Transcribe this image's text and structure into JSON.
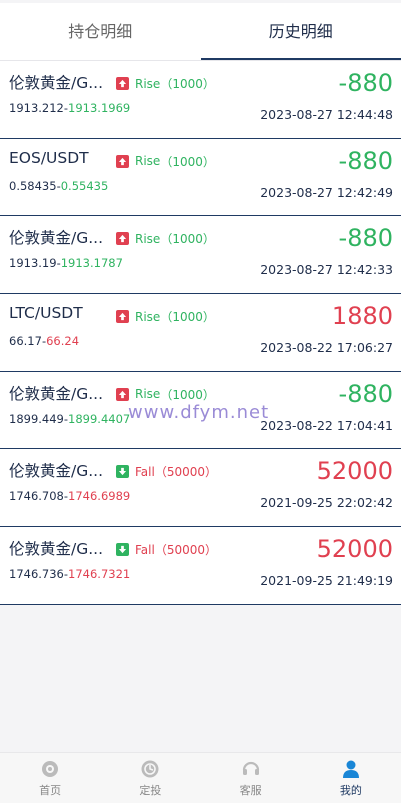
{
  "tabs": [
    {
      "label": "持仓明细",
      "active": false
    },
    {
      "label": "历史明细",
      "active": true
    }
  ],
  "records": [
    {
      "name": "伦敦黄金/G...",
      "direction": "Rise",
      "qty": "（1000）",
      "open": "1913.212",
      "close": "1913.1969",
      "close_color": "green",
      "amount": "-880",
      "amount_color": "green",
      "time": "2023-08-27 12:44:48"
    },
    {
      "name": "EOS/USDT",
      "direction": "Rise",
      "qty": "（1000）",
      "open": "0.58435",
      "close": "0.55435",
      "close_color": "green",
      "amount": "-880",
      "amount_color": "green",
      "time": "2023-08-27 12:42:49"
    },
    {
      "name": "伦敦黄金/G...",
      "direction": "Rise",
      "qty": "（1000）",
      "open": "1913.19",
      "close": "1913.1787",
      "close_color": "green",
      "amount": "-880",
      "amount_color": "green",
      "time": "2023-08-27 12:42:33"
    },
    {
      "name": "LTC/USDT",
      "direction": "Rise",
      "qty": "（1000）",
      "open": "66.17",
      "close": "66.24",
      "close_color": "red",
      "amount": "1880",
      "amount_color": "red",
      "time": "2023-08-22 17:06:27"
    },
    {
      "name": "伦敦黄金/G...",
      "direction": "Rise",
      "qty": "（1000）",
      "open": "1899.449",
      "close": "1899.4407",
      "close_color": "green",
      "amount": "-880",
      "amount_color": "green",
      "time": "2023-08-22 17:04:41"
    },
    {
      "name": "伦敦黄金/G...",
      "direction": "Fall",
      "qty": "（50000）",
      "open": "1746.708",
      "close": "1746.6989",
      "close_color": "red",
      "amount": "52000",
      "amount_color": "red",
      "time": "2021-09-25 22:02:42"
    },
    {
      "name": "伦敦黄金/G...",
      "direction": "Fall",
      "qty": "（50000）",
      "open": "1746.736",
      "close": "1746.7321",
      "close_color": "red",
      "amount": "52000",
      "amount_color": "red",
      "time": "2021-09-25 21:49:19"
    }
  ],
  "watermark": "www.dfym.net",
  "nav": [
    {
      "label": "首页",
      "icon": "home-icon",
      "active": false
    },
    {
      "label": "定投",
      "icon": "invest-icon",
      "active": false
    },
    {
      "label": "客服",
      "icon": "headset-icon",
      "active": false
    },
    {
      "label": "我的",
      "icon": "user-icon",
      "active": true
    }
  ],
  "colors": {
    "rise": "#2fb360",
    "fall": "#e04050",
    "primary": "#1f3a63"
  }
}
